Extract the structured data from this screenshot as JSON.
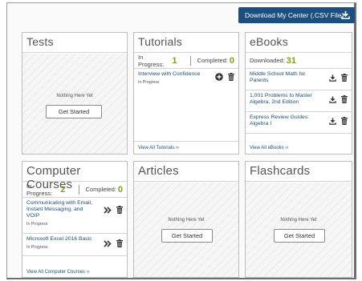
{
  "header": {
    "download_label": "Download My Center (.CSV File)"
  },
  "colors": {
    "accent": "#1c4f7f",
    "count_green": "#7ea21b",
    "card_border": "#bdbdbd"
  },
  "tests": {
    "title": "Tests",
    "empty_text": "Nothing Here Yet",
    "button_label": "Get Started"
  },
  "tutorials": {
    "title": "Tutorials",
    "in_progress_label": "In Progress:",
    "in_progress_count": "1",
    "completed_label": "Completed:",
    "completed_count": "0",
    "items": [
      {
        "title": "Interview with Confidence",
        "status": "In Progress",
        "icons": [
          "plus-circle-icon",
          "trash-icon"
        ]
      }
    ],
    "view_all": "View All Tutorials"
  },
  "ebooks": {
    "title": "eBooks",
    "downloaded_label": "Downloaded:",
    "downloaded_count": "31",
    "items": [
      {
        "title_lines": [
          "Middle School Math for",
          "Parents"
        ],
        "icons": [
          "download-icon",
          "trash-icon"
        ]
      },
      {
        "title_lines": [
          "1,001 Problems to Master",
          "Algebra, 2nd Edition"
        ],
        "icons": [
          "download-icon",
          "trash-icon"
        ]
      },
      {
        "title_lines": [
          "Express Review Guides:",
          "Algebra I"
        ],
        "icons": [
          "download-icon",
          "trash-icon"
        ]
      }
    ],
    "view_all": "View All eBooks"
  },
  "computer_courses": {
    "title": "Computer Courses",
    "in_progress_label": "In Progress:",
    "in_progress_count": "2",
    "completed_label": "Completed:",
    "completed_count": "0",
    "items": [
      {
        "title_lines": [
          "Communicating with Email,",
          "Instant Messaging, and",
          "VOIP"
        ],
        "status": "In Progress",
        "icons": [
          "double-chevron-right-icon",
          "trash-icon"
        ]
      },
      {
        "title_lines": [
          "Microsoft Excel 2016 Basic"
        ],
        "status": "In Progress",
        "icons": [
          "double-chevron-right-icon",
          "trash-icon"
        ]
      }
    ],
    "view_all": "View All Computer Courses"
  },
  "articles": {
    "title": "Articles",
    "empty_text": "Nothing Here Yet",
    "button_label": "Get Started"
  },
  "flashcards": {
    "title": "Flashcards",
    "empty_text": "Nothing Here Yet",
    "button_label": "Get Started"
  }
}
